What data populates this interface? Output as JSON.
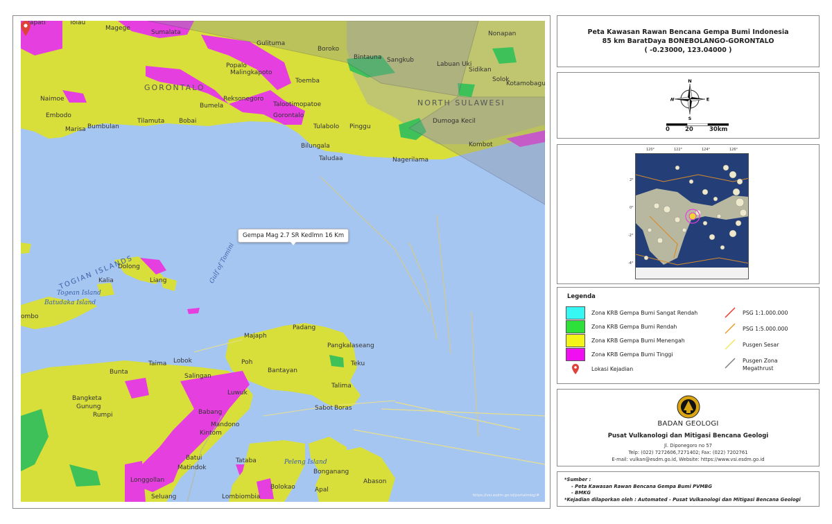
{
  "map": {
    "popup_text": "Gempa Mag 2.7 SR Kedlmn 16 Km",
    "attribution": "https://vsi.esdm.go.id/portalmbg/#",
    "regions": [
      "GORONTALO",
      "NORTH SULAWESI"
    ],
    "islands_label": "TOGIAN ISLANDS",
    "gulf_label": "Gulf of Tomini",
    "water_labels": [
      "Togean Island",
      "Batudaka Island",
      "Peleng Island"
    ],
    "places": [
      "Dapati",
      "Tolau",
      "Magege",
      "Sumalata",
      "Gulituma",
      "Boroko",
      "Bintauna",
      "Sangkub",
      "Labuan Uki",
      "Nonapan",
      "Popalo",
      "Malingkapoto",
      "Toemba",
      "Sidikan",
      "Solok",
      "Gorontalo_",
      "Bumela",
      "Reksonegoro",
      "Talootimopatoe",
      "Kotamobagu",
      "Naimoe",
      "Embodo",
      "Bumbulan",
      "Tilamuta",
      "Bobai",
      "Gorontalo",
      "Tulabolo",
      "Pinggu",
      "Dumoga Kecil",
      "Marisa",
      "Kombot",
      "Bilungala",
      "Taludaa",
      "Nagerilama",
      "Dolong",
      "Liang",
      "Kalia",
      "ombo",
      "Padang",
      "Majaph",
      "Pangkalaseang",
      "Taima",
      "Lobok",
      "Poh",
      "Bantayan",
      "Teku",
      "Bunta",
      "Salingan",
      "Talima",
      "Bangketa",
      "Luwuk",
      "Gunung",
      "Sabot",
      "Boras",
      "Babang",
      "Mandono",
      "Kintom",
      "Batui",
      "Matindok",
      "Tataba",
      "Bonganang",
      "Longgollan",
      "Bolokao",
      "Abason",
      "Seluang",
      "Lombiombia",
      "Apal",
      "Rumpi"
    ]
  },
  "title": {
    "line1": "Peta Kawasan Rawan Bencana Gempa Bumi Indonesia",
    "line2": "85 km BaratDaya BONEBOLANGO-GORONTALO",
    "line3": "( -0.23000, 123.04000 )"
  },
  "compass": {
    "n": "N",
    "s": "S",
    "e": "E",
    "w": "W"
  },
  "scale": {
    "labels": [
      "0",
      "20",
      "30km"
    ]
  },
  "inset": {
    "lon_ticks": [
      "120°",
      "122°",
      "124°",
      "126°"
    ],
    "lat_ticks": [
      "2°",
      "0°",
      "-2°",
      "-4°"
    ]
  },
  "legend": {
    "title": "Legenda",
    "zones": [
      {
        "label": "Zona KRB Gempa Bumi Sangat Rendah",
        "color": "#36f7f4"
      },
      {
        "label": "Zona KRB Gempa Bumi Rendah",
        "color": "#2de03a"
      },
      {
        "label": "Zona KRB Gempa Bumi Menengah",
        "color": "#f4f418"
      },
      {
        "label": "Zona KRB Gempa Bumi Tinggi",
        "color": "#f00ff0"
      }
    ],
    "event": "Lokasi Kejadian",
    "lines": [
      {
        "label": "PSG 1:1.000.000",
        "color": "#e83a2a"
      },
      {
        "label": "PSG 1:5.000.000",
        "color": "#e89a2a"
      },
      {
        "label": "Pusgen Sesar",
        "color": "#f2e65a"
      },
      {
        "label": "Pusgen Zona Megathrust",
        "color": "#7f7f7f"
      }
    ]
  },
  "agency": {
    "name": "BADAN GEOLOGI",
    "org": "Pusat Vulkanologi dan Mitigasi Bencana Geologi",
    "address": "Jl. Diponegoro no 57",
    "phone": "Telp: (022) 7272606,7271402; Fax: (022) 7202761",
    "contact": "E-mail: vulkan@esdm.go.id, Website: https://www.vsi.esdm.go.id"
  },
  "source": {
    "heading": "*Sumber :",
    "items": [
      "- Peta Kawasan Rawan Bencana Gempa Bumi PVMBG",
      "- BMKG"
    ],
    "footnote": "*Kejadian dilaporkan oleh : Automated - Pusat Vulkanologi dan Mitigasi Bencana Geologi"
  }
}
